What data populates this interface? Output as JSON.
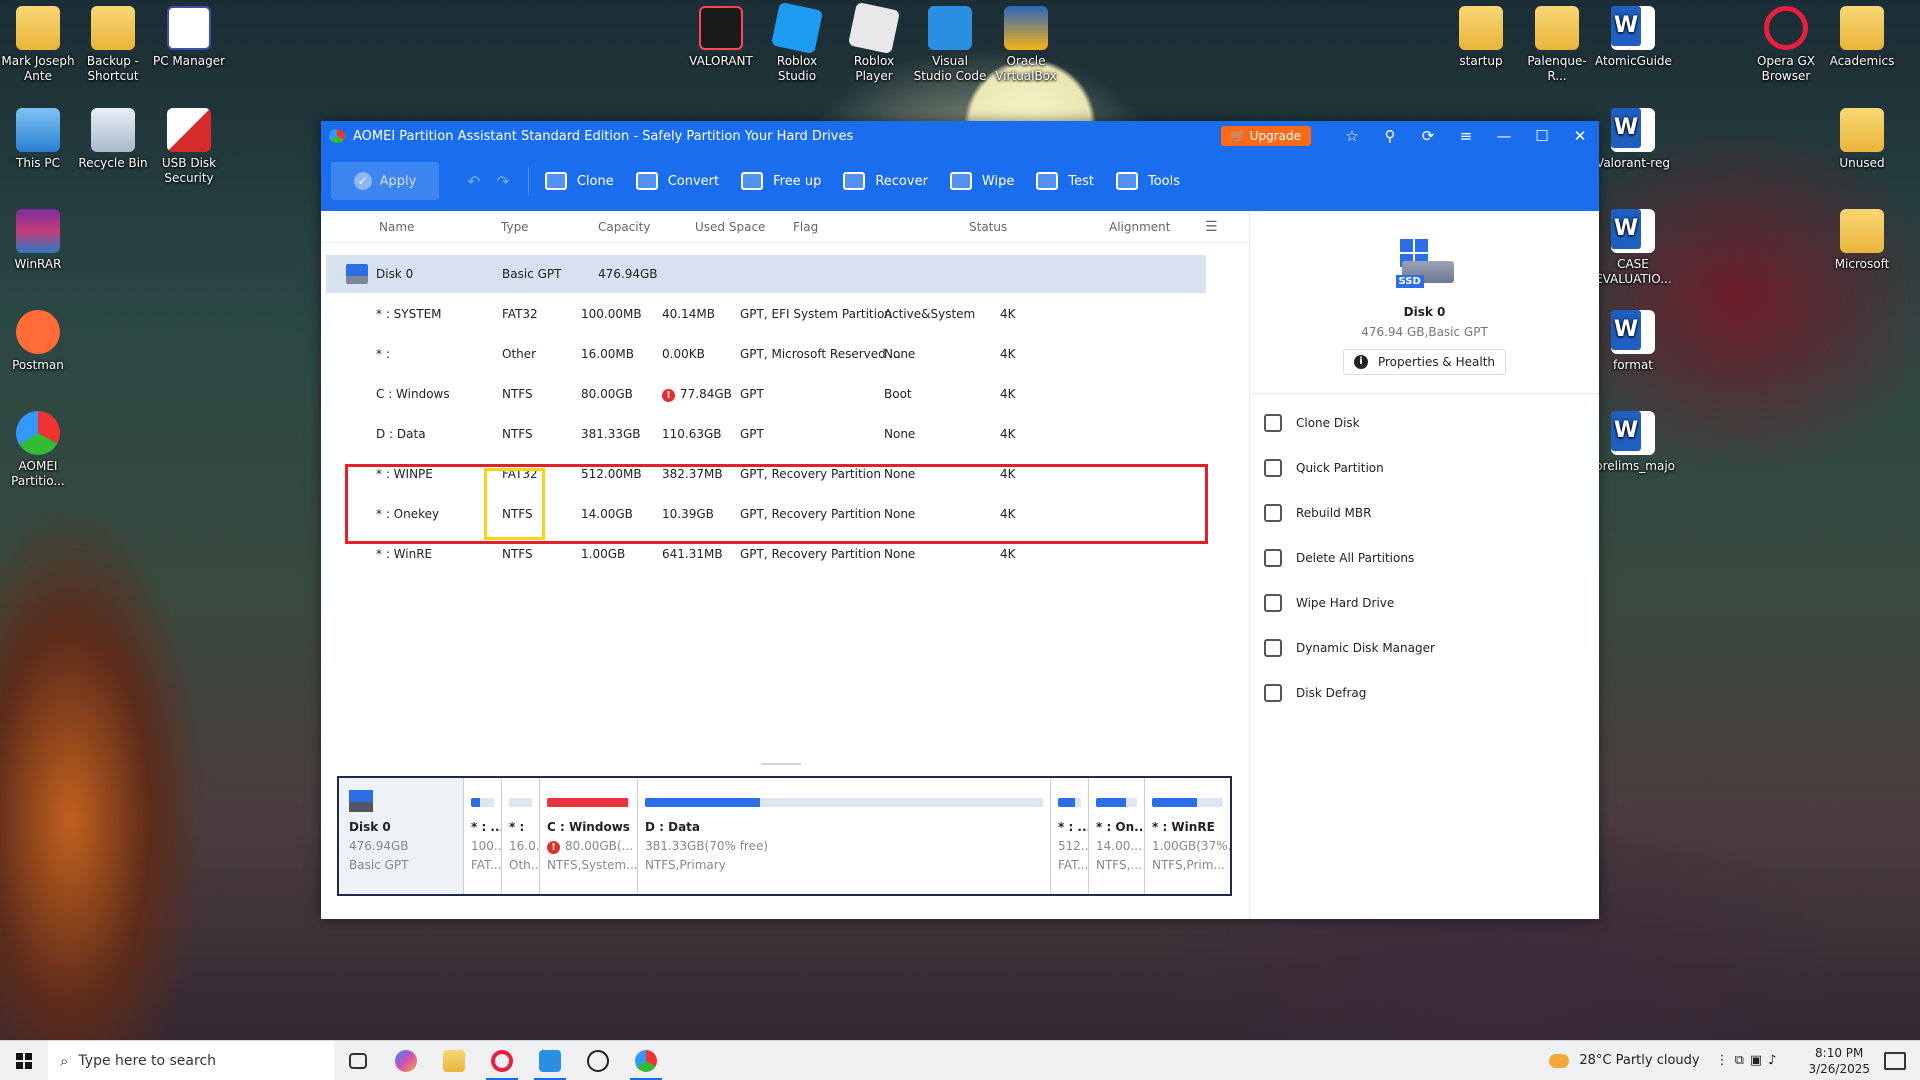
{
  "desktop_icons": [
    {
      "label": "Mark Joseph Ante"
    },
    {
      "label": "Backup - Shortcut"
    },
    {
      "label": "PC Manager"
    },
    {
      "label": "This PC"
    },
    {
      "label": "Recycle Bin"
    },
    {
      "label": "USB Disk Security"
    },
    {
      "label": "WinRAR"
    },
    {
      "label": "Postman"
    },
    {
      "label": "AOMEI Partitio..."
    },
    {
      "label": "VALORANT"
    },
    {
      "label": "Roblox Studio"
    },
    {
      "label": "Roblox Player"
    },
    {
      "label": "Visual Studio Code"
    },
    {
      "label": "Oracle VirtualBox"
    },
    {
      "label": "startup"
    },
    {
      "label": "Palenque-R..."
    },
    {
      "label": "AtomicGuide"
    },
    {
      "label": "Opera GX Browser"
    },
    {
      "label": "Academics"
    },
    {
      "label": "Valorant-reg"
    },
    {
      "label": "Unused"
    },
    {
      "label": "CASE EVALUATIO..."
    },
    {
      "label": "Microsoft"
    },
    {
      "label": "format"
    },
    {
      "label": "prelims_majo"
    }
  ],
  "window": {
    "title": "AOMEI Partition Assistant Standard Edition - Safely Partition Your Hard Drives",
    "upgrade": "Upgrade"
  },
  "toolbar": {
    "apply": "Apply",
    "tools": [
      "Clone",
      "Convert",
      "Free up",
      "Recover",
      "Wipe",
      "Test",
      "Tools"
    ]
  },
  "table": {
    "headers": [
      "Name",
      "Type",
      "Capacity",
      "Used Space",
      "Flag",
      "Status",
      "Alignment"
    ],
    "disk": {
      "name": "Disk 0",
      "type": "Basic GPT",
      "capacity": "476.94GB"
    },
    "rows": [
      {
        "name": "* : SYSTEM",
        "type": "FAT32",
        "capacity": "100.00MB",
        "used": "40.14MB",
        "flag": "GPT, EFI System Partition",
        "status": "Active&System",
        "align": "4K"
      },
      {
        "name": "* :",
        "type": "Other",
        "capacity": "16.00MB",
        "used": "0.00KB",
        "flag": "GPT, Microsoft Reserved ...",
        "status": "None",
        "align": "4K"
      },
      {
        "name": "C : Windows",
        "type": "NTFS",
        "capacity": "80.00GB",
        "used": "77.84GB",
        "flag": "GPT",
        "status": "Boot",
        "align": "4K"
      },
      {
        "name": "D : Data",
        "type": "NTFS",
        "capacity": "381.33GB",
        "used": "110.63GB",
        "flag": "GPT",
        "status": "None",
        "align": "4K"
      },
      {
        "name": "* : WINPE",
        "type": "FAT32",
        "capacity": "512.00MB",
        "used": "382.37MB",
        "flag": "GPT, Recovery Partition",
        "status": "None",
        "align": "4K"
      },
      {
        "name": "* : Onekey",
        "type": "NTFS",
        "capacity": "14.00GB",
        "used": "10.39GB",
        "flag": "GPT, Recovery Partition",
        "status": "None",
        "align": "4K"
      },
      {
        "name": "* : WinRE",
        "type": "NTFS",
        "capacity": "1.00GB",
        "used": "641.31MB",
        "flag": "GPT, Recovery Partition",
        "status": "None",
        "align": "4K"
      }
    ]
  },
  "diskmap": {
    "disk": {
      "name": "Disk 0",
      "size": "476.94GB",
      "type": "Basic GPT"
    },
    "parts": [
      {
        "name": "* : ...",
        "l2": "100...",
        "l3": "FAT...",
        "fill": 0.4
      },
      {
        "name": "* :",
        "l2": "16.0...",
        "l3": "Oth...",
        "fill": 0
      },
      {
        "name": "C : Windows",
        "l2": "80.00GB(...",
        "l3": "NTFS,System...",
        "fill": 0.97
      },
      {
        "name": "D : Data",
        "l2": "381.33GB(70% free)",
        "l3": "NTFS,Primary",
        "fill": 0.29
      },
      {
        "name": "* : ...",
        "l2": "512...",
        "l3": "FAT...",
        "fill": 0.75
      },
      {
        "name": "* : On...",
        "l2": "14.00...",
        "l3": "NTFS,...",
        "fill": 0.74
      },
      {
        "name": "* : WinRE",
        "l2": "1.00GB(37%...",
        "l3": "NTFS,Prim...",
        "fill": 0.63
      }
    ]
  },
  "side": {
    "disk": "Disk 0",
    "sub": "476.94 GB,Basic GPT",
    "props": "Properties & Health",
    "ssd": "SSD",
    "ops": [
      "Clone Disk",
      "Quick Partition",
      "Rebuild MBR",
      "Delete All Partitions",
      "Wipe Hard Drive",
      "Dynamic Disk Manager",
      "Disk Defrag"
    ]
  },
  "taskbar": {
    "search": "Type here to search",
    "weather": "28°C  Partly cloudy",
    "time": "8:10 PM",
    "date": "3/26/2025"
  }
}
